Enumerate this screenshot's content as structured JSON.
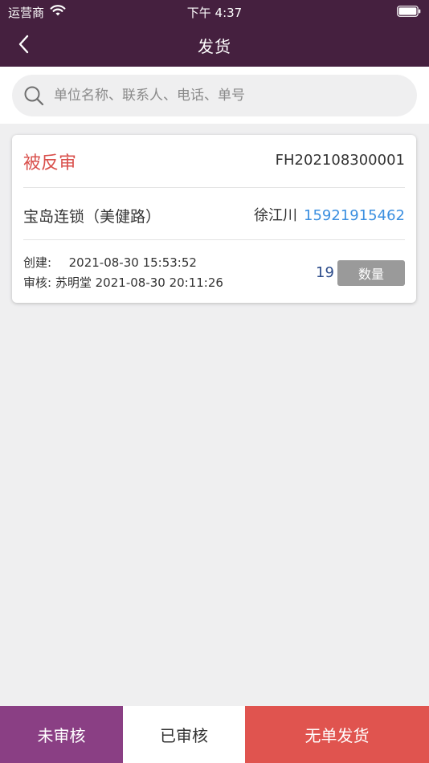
{
  "status_bar": {
    "carrier": "运营商",
    "time": "下午 4:37"
  },
  "nav": {
    "title": "发货"
  },
  "search": {
    "placeholder": "单位名称、联系人、电话、单号",
    "value": ""
  },
  "orders": [
    {
      "status": "被反审",
      "order_no": "FH202108300001",
      "customer": "宝岛连锁（美健路）",
      "contact_name": "徐江川",
      "contact_phone": "15921915462",
      "created_label": "创建:",
      "created_at": "2021-08-30 15:53:52",
      "reviewed_label": "审核:",
      "reviewer": "苏明堂",
      "reviewed_at": "2021-08-30 20:11:26",
      "quantity": "19",
      "quantity_button": "数量"
    }
  ],
  "tabs": {
    "unreviewed": "未审核",
    "reviewed": "已审核",
    "no_order_ship": "无单发货"
  },
  "colors": {
    "header_bg": "#45203f",
    "status_red": "#d9504c",
    "phone_blue": "#3b8fe0",
    "tab_purple": "#8a3f84",
    "tab_red": "#e0544f"
  }
}
